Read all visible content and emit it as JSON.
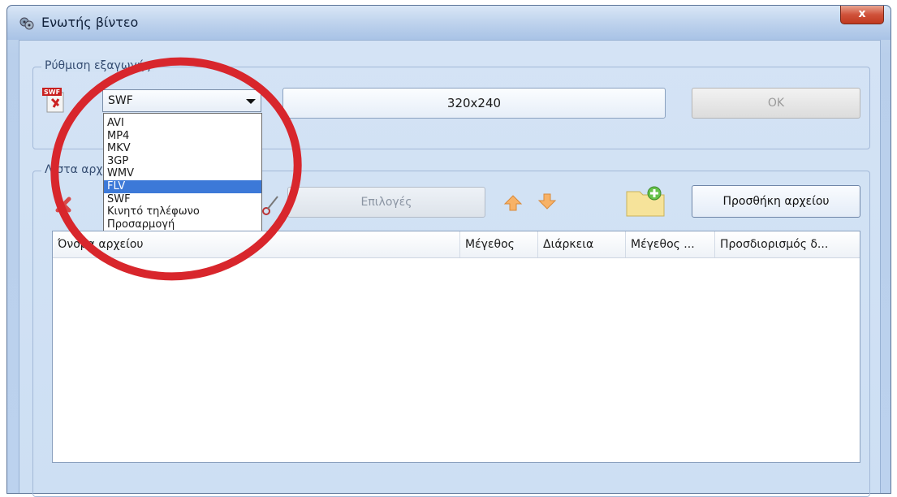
{
  "window": {
    "title": "Ενωτής βίντεο",
    "close_label": "x"
  },
  "export_settings": {
    "group_label": "Ρύθμιση εξαγωγής",
    "format_icon_text": "SWF",
    "format_selected": "SWF",
    "format_options": [
      "AVI",
      "MP4",
      "MKV",
      "3GP",
      "WMV",
      "FLV",
      "SWF",
      "Κινητό τηλέφωνο",
      "Προσαρμογή"
    ],
    "highlighted_option": "FLV",
    "resolution": "320x240",
    "ok_label": "OK"
  },
  "file_list": {
    "group_label": "Λίστα αρχείων",
    "options_label": "Επιλογές",
    "add_file_label": "Προσθήκη αρχείου",
    "columns": [
      "Όνομα αρχείου",
      "Μέγεθος",
      "Διάρκεια",
      "Μέγεθος ...",
      "Προσδιορισμός δ..."
    ]
  },
  "colors": {
    "annotation": "#d8262c",
    "highlight": "#3c79d8"
  }
}
